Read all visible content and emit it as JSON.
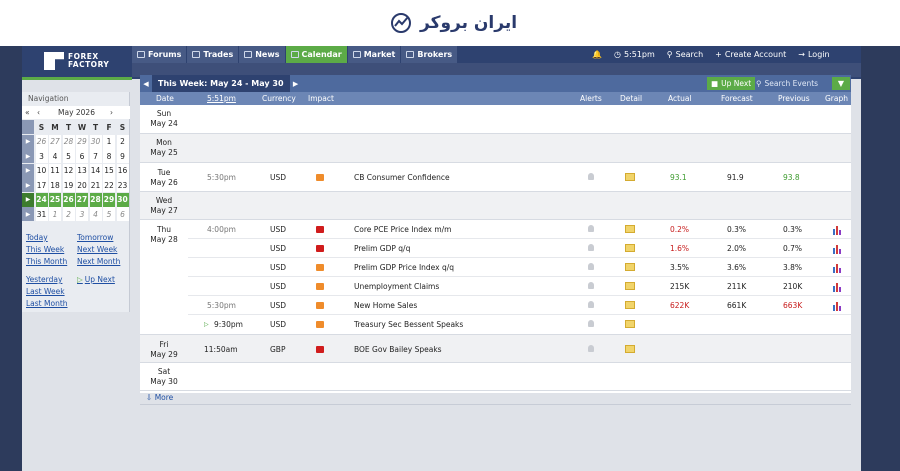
{
  "watermark": {
    "text": "ایران بروکر"
  },
  "logo": {
    "line1": "FOREX",
    "line2": "FACTORY"
  },
  "nav": [
    {
      "label": "Forums",
      "icon": "forums-icon",
      "active": false
    },
    {
      "label": "Trades",
      "icon": "trades-icon",
      "active": false
    },
    {
      "label": "News",
      "icon": "news-icon",
      "active": false
    },
    {
      "label": "Calendar",
      "icon": "calendar-icon",
      "active": true
    },
    {
      "label": "Market",
      "icon": "market-icon",
      "active": false
    },
    {
      "label": "Brokers",
      "icon": "brokers-icon",
      "active": false
    }
  ],
  "navright": {
    "time": "5:51pm",
    "search": "Search",
    "create": "Create Account",
    "login": "Login"
  },
  "calendar": {
    "week_title": "This Week: May 24 - May 30",
    "up_next": "Up Next",
    "search_events": "Search Events",
    "columns": {
      "date": "Date",
      "time": "5:51pm",
      "currency": "Currency",
      "impact": "Impact",
      "alerts": "Alerts",
      "detail": "Detail",
      "actual": "Actual",
      "forecast": "Forecast",
      "previous": "Previous",
      "graph": "Graph"
    },
    "more": "More"
  },
  "days": [
    {
      "d1": "Sun",
      "d2": "May 24"
    },
    {
      "d1": "Mon",
      "d2": "May 25"
    },
    {
      "d1": "Tue",
      "d2": "May 26"
    },
    {
      "d1": "Wed",
      "d2": "May 27"
    },
    {
      "d1": "Thu",
      "d2": "May 28"
    },
    {
      "d1": "Fri",
      "d2": "May 29"
    },
    {
      "d1": "Sat",
      "d2": "May 30"
    }
  ],
  "events": [
    {
      "time": "5:30pm",
      "currency": "USD",
      "impact": "orange",
      "name": "CB Consumer Confidence",
      "actual": "93.1",
      "actual_color": "green",
      "forecast": "91.9",
      "previous": "93.8",
      "previous_color": "green",
      "graph": false
    },
    {
      "time": "4:00pm",
      "currency": "USD",
      "impact": "red",
      "name": "Core PCE Price Index m/m",
      "actual": "0.2%",
      "actual_color": "red",
      "forecast": "0.3%",
      "previous": "0.3%",
      "previous_color": "",
      "graph": true
    },
    {
      "time": "",
      "currency": "USD",
      "impact": "red",
      "name": "Prelim GDP q/q",
      "actual": "1.6%",
      "actual_color": "red",
      "forecast": "2.0%",
      "previous": "0.7%",
      "previous_color": "",
      "graph": true
    },
    {
      "time": "",
      "currency": "USD",
      "impact": "orange",
      "name": "Prelim GDP Price Index q/q",
      "actual": "3.5%",
      "actual_color": "",
      "forecast": "3.6%",
      "previous": "3.8%",
      "previous_color": "",
      "graph": true
    },
    {
      "time": "",
      "currency": "USD",
      "impact": "orange",
      "name": "Unemployment Claims",
      "actual": "215K",
      "actual_color": "",
      "forecast": "211K",
      "previous": "210K",
      "previous_color": "",
      "graph": true
    },
    {
      "time": "5:30pm",
      "currency": "USD",
      "impact": "orange",
      "name": "New Home Sales",
      "actual": "622K",
      "actual_color": "red",
      "forecast": "661K",
      "previous": "663K",
      "previous_color": "red",
      "graph": true
    },
    {
      "time": "9:30pm",
      "currency": "USD",
      "impact": "orange",
      "name": "Treasury Sec Bessent Speaks",
      "actual": "",
      "actual_color": "",
      "forecast": "",
      "previous": "",
      "previous_color": "",
      "graph": false
    },
    {
      "time": "11:50am",
      "currency": "GBP",
      "impact": "red",
      "name": "BOE Gov Bailey Speaks",
      "actual": "",
      "actual_color": "",
      "forecast": "",
      "previous": "",
      "previous_color": "",
      "graph": false
    }
  ],
  "sidebar": {
    "label": "Navigation",
    "month": "May 2026",
    "weekdays": [
      "S",
      "M",
      "T",
      "W",
      "T",
      "F",
      "S"
    ],
    "weeks": [
      [
        "26",
        "27",
        "28",
        "29",
        "30",
        "1",
        "2"
      ],
      [
        "3",
        "4",
        "5",
        "6",
        "7",
        "8",
        "9"
      ],
      [
        "10",
        "11",
        "12",
        "13",
        "14",
        "15",
        "16"
      ],
      [
        "17",
        "18",
        "19",
        "20",
        "21",
        "22",
        "23"
      ],
      [
        "24",
        "25",
        "26",
        "27",
        "28",
        "29",
        "30"
      ],
      [
        "31",
        "1",
        "2",
        "3",
        "4",
        "5",
        "6"
      ]
    ],
    "links": {
      "today": "Today",
      "tomorrow": "Tomorrow",
      "this_week": "This Week",
      "next_week": "Next Week",
      "this_month": "This Month",
      "next_month": "Next Month",
      "yesterday": "Yesterday",
      "up_next": "Up Next",
      "last_week": "Last Week",
      "last_month": "Last Month"
    }
  },
  "colors": {
    "navy": "#2e4270",
    "green": "#5cab47",
    "red": "#d01c1c",
    "orange": "#ef8c2b"
  }
}
